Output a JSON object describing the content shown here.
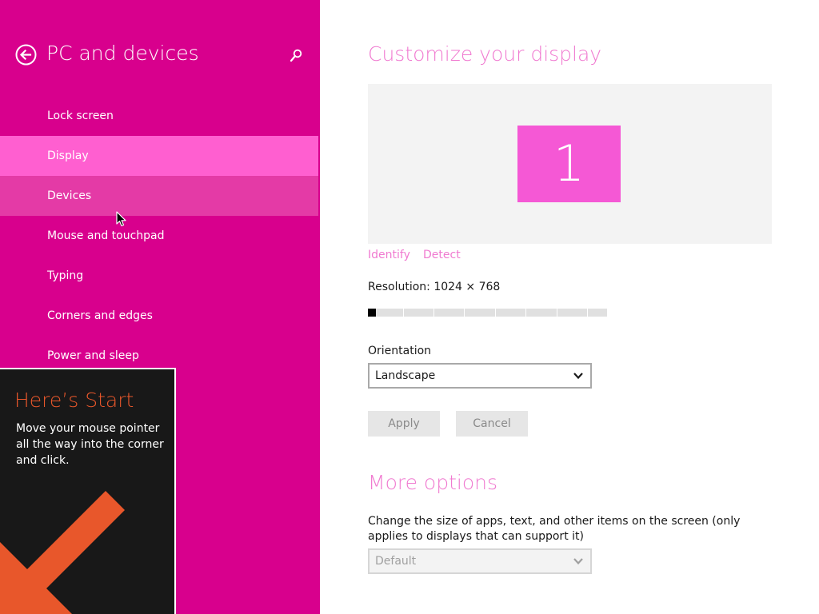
{
  "window": {
    "accent": "#d8008d"
  },
  "left_pane": {
    "title": "PC and devices",
    "back_icon": "back-arrow-icon",
    "search_icon": "search-icon",
    "nav_items": [
      {
        "label": "Lock screen",
        "state": "normal"
      },
      {
        "label": "Display",
        "state": "selected"
      },
      {
        "label": "Devices",
        "state": "hover"
      },
      {
        "label": "Mouse and touchpad",
        "state": "normal"
      },
      {
        "label": "Typing",
        "state": "normal"
      },
      {
        "label": "Corners and edges",
        "state": "normal"
      },
      {
        "label": "Power and sleep",
        "state": "normal"
      }
    ]
  },
  "start_tip": {
    "title": "Here’s Start",
    "body": "Move your mouse pointer all the way into the corner and click.",
    "title_color": "#e8572b"
  },
  "main": {
    "heading": "Customize your display",
    "monitor_label": "1",
    "links": {
      "identify": "Identify",
      "detect": "Detect"
    },
    "resolution": {
      "label": "Resolution: 1024 × 768",
      "slider_position": 0,
      "slider_steps": 8
    },
    "orientation": {
      "label": "Orientation",
      "selected": "Landscape"
    },
    "buttons": {
      "apply": "Apply",
      "cancel": "Cancel"
    },
    "more_options": {
      "heading": "More options",
      "description": "Change the size of apps, text, and other items on the screen (only applies to displays that can support it)",
      "selected": "Default"
    }
  }
}
